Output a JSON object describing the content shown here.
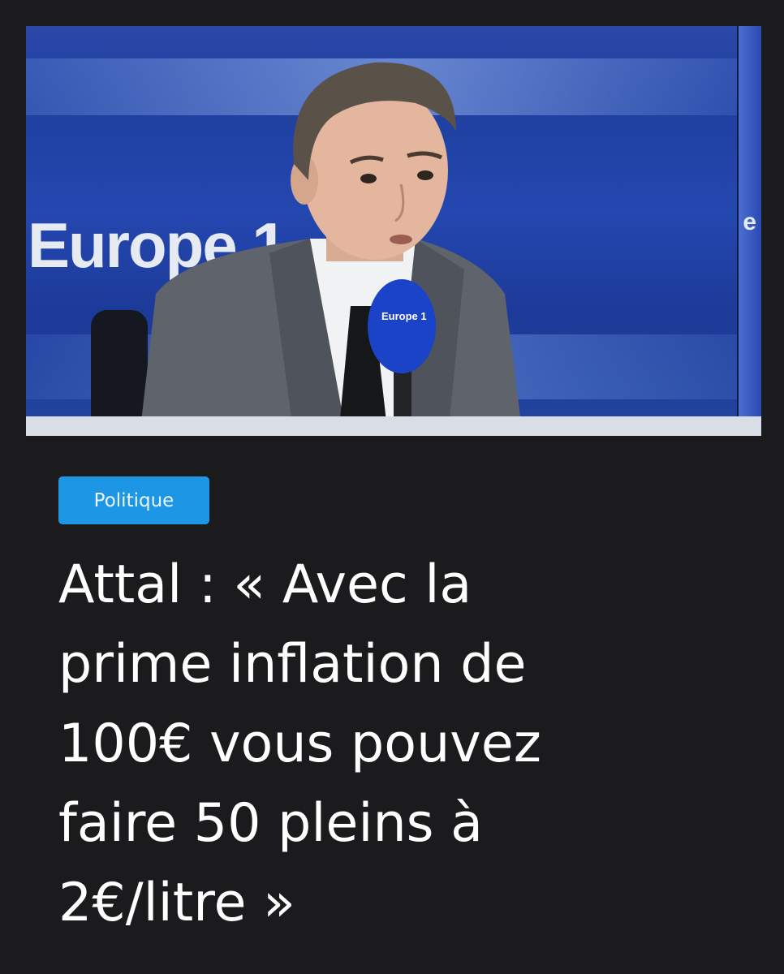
{
  "article": {
    "photo": {
      "alt_subject": "man speaking into microphone",
      "brand_text": "Europe 1",
      "brand_text_right": "e",
      "mic_text": "Europe 1"
    },
    "category_label": "Politique",
    "headline": "Attal : « Avec la\nprime inflation de\n100€ vous pouvez\nfaire 50 pleins à\n2€/litre »"
  },
  "colors": {
    "background": "#1b1b1d",
    "tag_background": "#1e96e6",
    "headline": "#ffffff"
  }
}
